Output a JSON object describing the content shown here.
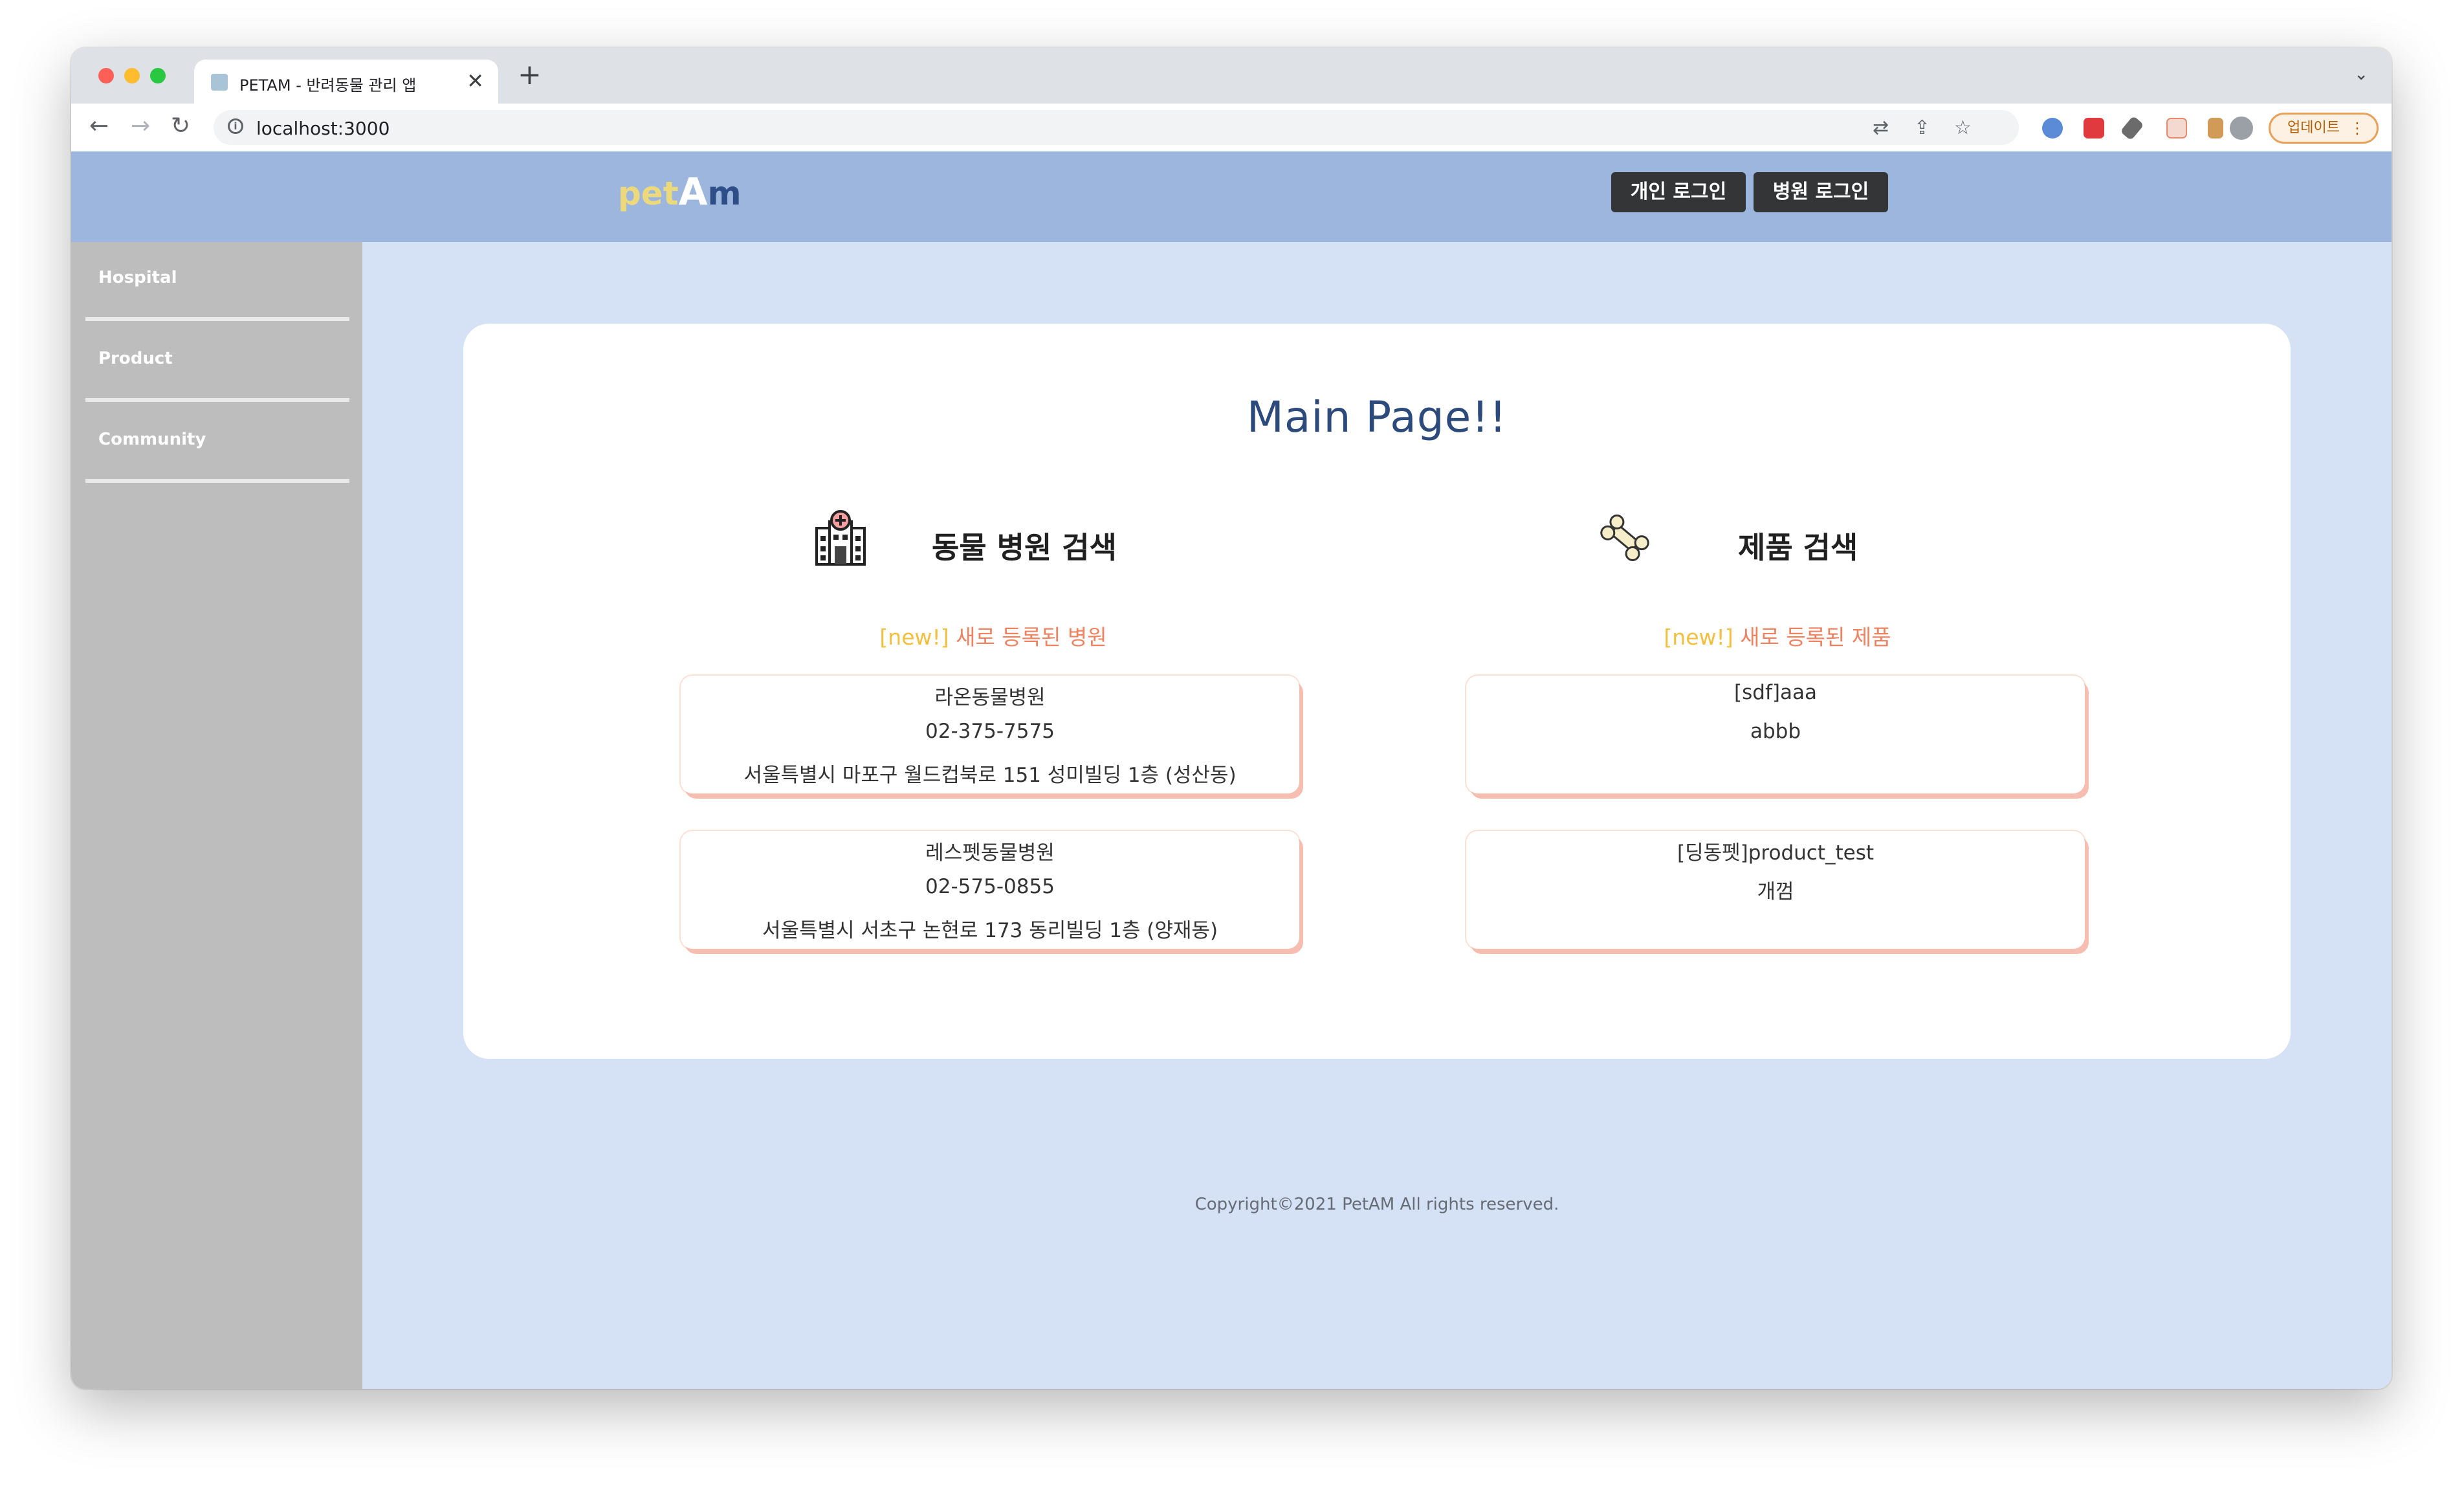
{
  "browser": {
    "tab_title": "PETAM - 반려동물 관리 앱",
    "tab_close": "✕",
    "new_tab": "+",
    "url": "localhost:3000",
    "update_label": "업데이트",
    "update_menu": "⋮",
    "tab_menu": "⌄"
  },
  "header": {
    "logo_pet": "pet",
    "logo_a": "A",
    "logo_m": "m",
    "personal_login": "개인 로그인",
    "hospital_login": "병원 로그인",
    "colors": {
      "header_bg": "#9db6de",
      "button_bg": "#333537"
    }
  },
  "sidebar": {
    "items": [
      {
        "label": "Hospital"
      },
      {
        "label": "Product"
      },
      {
        "label": "Community"
      }
    ]
  },
  "main": {
    "title": "Main Page!!",
    "hospital_section": {
      "title": "동물 병원 검색",
      "icon": "hospital-icon",
      "new_tag": "[new!]",
      "new_text": " 새로 등록된 병원",
      "items": [
        {
          "name": "라온동물병원",
          "phone": "02-375-7575",
          "address": "서울특별시 마포구 월드컵북로 151 성미빌딩 1층 (성산동)"
        },
        {
          "name": "레스펫동물병원",
          "phone": "02-575-0855",
          "address": "서울특별시 서초구 논현로 173 동리빌딩 1층 (양재동)"
        }
      ]
    },
    "product_section": {
      "title": "제품 검색",
      "icon": "bone-icon",
      "new_tag": "[new!]",
      "new_text": " 새로 등록된 제품",
      "items": [
        {
          "name": "[sdf]aaa",
          "desc": "abbb"
        },
        {
          "name": "[딩동펫]product_test",
          "desc": "개껌"
        }
      ]
    }
  },
  "footer": {
    "copyright": "Copyright©2021 PetAM All rights reserved."
  }
}
